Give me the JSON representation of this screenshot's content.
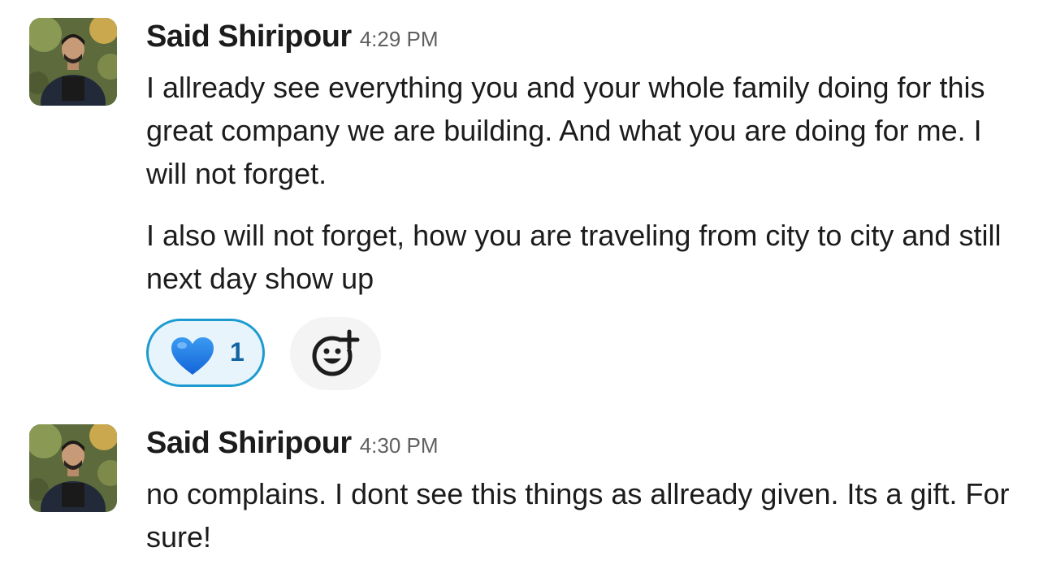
{
  "messages": [
    {
      "author": "Said Shiripour",
      "time": "4:29 PM",
      "paragraphs": [
        "I allready see everything you and your whole family doing for this great company we are building. And what you are doing for me. I will not forget.",
        "I also will not forget, how you are traveling from city to city and still next day show up"
      ],
      "reactions": [
        {
          "emoji": "blue-heart",
          "count": "1",
          "color": "#1d9bd1"
        }
      ],
      "add_reaction_icon": "add-emoji-icon"
    },
    {
      "author": "Said Shiripour",
      "time": "4:30 PM",
      "paragraphs": [
        "no complains. I dont see this things as allready given. Its a gift. For sure!"
      ]
    }
  ],
  "colors": {
    "reaction_border": "#1d9bd1",
    "reaction_bg": "#e8f4fb",
    "reaction_count": "#1264a3",
    "timestamp": "#616061"
  }
}
